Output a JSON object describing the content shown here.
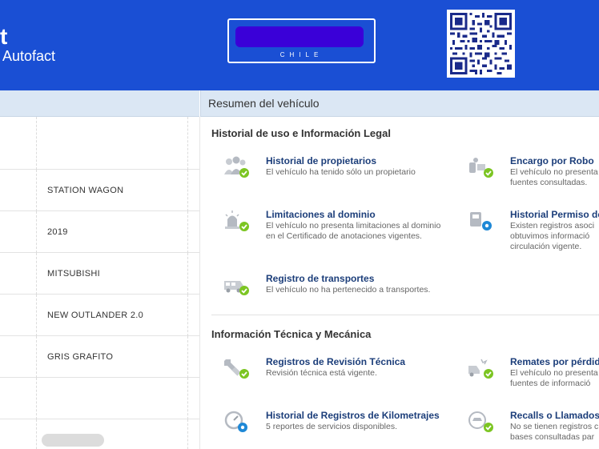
{
  "header": {
    "brand_mark": "t",
    "brand_name": "Autofact",
    "plate_country": "CHILE"
  },
  "sidebar": {
    "rows": [
      {
        "value": ""
      },
      {
        "value": "STATION WAGON"
      },
      {
        "value": "2019"
      },
      {
        "value": "MITSUBISHI"
      },
      {
        "value": "NEW OUTLANDER 2.0"
      },
      {
        "value": "GRIS GRAFITO"
      },
      {
        "value": ""
      },
      {
        "value": ""
      }
    ]
  },
  "summary": {
    "title": "Resumen del vehículo",
    "legal_title": "Historial de uso e Información Legal",
    "tech_title": "Información Técnica y Mecánica",
    "items": {
      "propietarios": {
        "title": "Historial de propietarios",
        "desc1": "El vehículo ha tenido sólo un propietario",
        "desc2": "",
        "icon": "people-check-icon"
      },
      "robo": {
        "title": "Encargo por Robo",
        "desc1": "El vehículo no presenta",
        "desc2": "fuentes consultadas.",
        "icon": "car-theft-check-icon"
      },
      "limitaciones": {
        "title": "Limitaciones al dominio",
        "desc1": "El vehículo no presenta limitaciones al dominio",
        "desc2": "en el Certificado de anotaciones vigentes.",
        "icon": "siren-check-icon"
      },
      "permiso": {
        "title": "Historial Permiso de",
        "desc1": "Existen registros asoci",
        "desc2": "obtuvimos informació",
        "desc3": "circulación vigente.",
        "icon": "car-gear-icon"
      },
      "transportes": {
        "title": "Registro de transportes",
        "desc1": "El vehículo no ha pertenecido a transportes.",
        "desc2": "",
        "icon": "bus-check-icon"
      },
      "revision": {
        "title": "Registros de Revisión Técnica",
        "desc1": "Revisión técnica está vigente.",
        "desc2": "",
        "icon": "wrench-check-icon"
      },
      "remates": {
        "title": "Remates por pérdid",
        "desc1": "El vehículo no presenta",
        "desc2": "fuentes de informació",
        "icon": "crash-check-icon"
      },
      "kilometrajes": {
        "title": "Historial de Registros de Kilometrajes",
        "desc1": "5 reportes de servicios disponibles.",
        "desc2": "",
        "icon": "odometer-gear-icon"
      },
      "recalls": {
        "title": "Recalls o Llamados",
        "desc1": "No se tienen registros c",
        "desc2": "bases consultadas par",
        "icon": "recall-check-icon"
      }
    }
  },
  "colors": {
    "header_bg": "#1a4fd4",
    "section_bar": "#dbe7f4",
    "title_blue": "#1c3e7a",
    "check_green": "#7cc522",
    "gear_blue": "#1e88d6"
  }
}
